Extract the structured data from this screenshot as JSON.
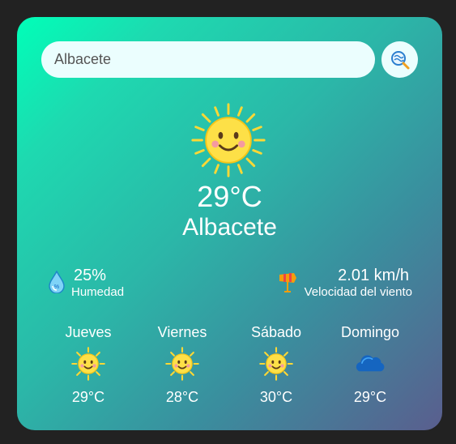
{
  "search": {
    "value": "Albacete",
    "button_icon": "search-icon"
  },
  "current": {
    "icon": "sun-icon",
    "temperature": "29°C",
    "city": "Albacete"
  },
  "details": {
    "humidity": {
      "value": "25%",
      "label": "Humedad",
      "icon": "water-drop-icon"
    },
    "wind": {
      "value": "2.01 km/h",
      "label": "Velocidad del viento",
      "icon": "windsock-icon"
    }
  },
  "forecast": [
    {
      "day": "Jueves",
      "temp": "29°C",
      "icon": "sun-icon"
    },
    {
      "day": "Viernes",
      "temp": "28°C",
      "icon": "sun-icon"
    },
    {
      "day": "Sábado",
      "temp": "30°C",
      "icon": "sun-icon"
    },
    {
      "day": "Domingo",
      "temp": "29°C",
      "icon": "cloud-icon"
    }
  ],
  "colors": {
    "background": "#222222",
    "card_gradient_start": "#00ffb8",
    "card_gradient_end": "#5a5e8e",
    "input_bg": "#ebfefe",
    "sun": "#fdd835",
    "cloud": "#1565c0"
  }
}
